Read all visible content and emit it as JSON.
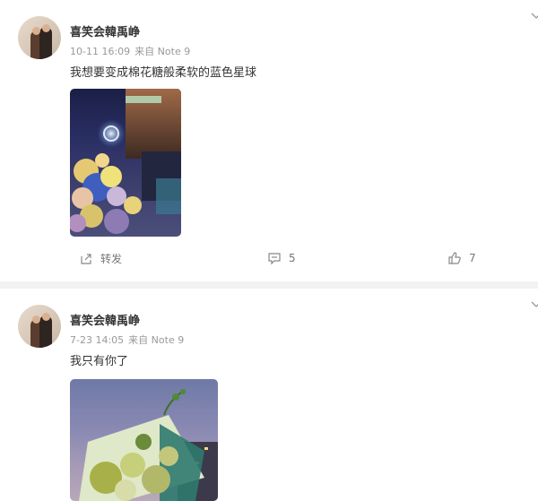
{
  "posts": [
    {
      "username": "喜笑会韓禹峥",
      "date": "10-11 16:09",
      "source": "来自 Note 9",
      "text": "我想要变成棉花糖般柔软的蓝色星球",
      "actions": {
        "repost_label": "转发",
        "comment_count": "5",
        "like_count": "7"
      }
    },
    {
      "username": "喜笑会韓禹峥",
      "date": "7-23 14:05",
      "source": "来自 Note 9",
      "text": "我只有你了"
    }
  ],
  "icons": [
    "chevron-down-icon",
    "repost-icon",
    "comment-icon",
    "like-icon"
  ]
}
